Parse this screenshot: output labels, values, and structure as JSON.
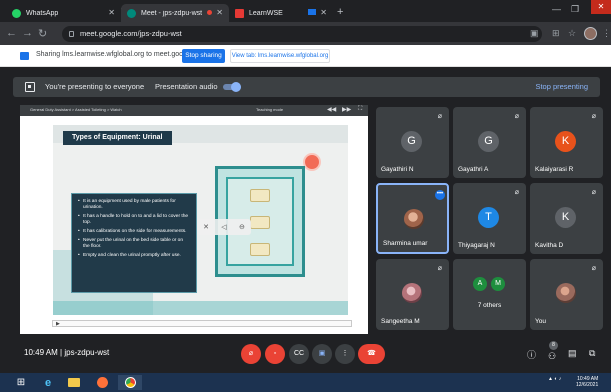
{
  "browser": {
    "tabs": [
      {
        "title": "WhatsApp",
        "favicon_color": "#25d366"
      },
      {
        "title": "Meet - jps-zdpu-wst",
        "favicon_color": "#00897b"
      },
      {
        "title": "LearnWSE",
        "favicon_color": "#e53935"
      }
    ],
    "url": "meet.google.com/jps-zdpu-wst"
  },
  "sharing_bar": {
    "message": "Sharing lms.learnwise.wfglobal.org to meet.google.com",
    "stop_label": "Stop sharing",
    "view_tab_label": "View tab: lms.learnwise.wfglobal.org"
  },
  "presenting_bar": {
    "status": "You're presenting to everyone",
    "audio_label": "Presentation audio",
    "stop_label": "Stop presenting"
  },
  "slide": {
    "breadcrumb": "General Duty Assistant  >  Assisted Toileting  >  Watch",
    "mode": "Teaching mode",
    "title": "Types of Equipment: Urinal",
    "bullets": [
      "It is an equipment used by male patients for urination.",
      "It has a handle to hold on to and a lid to cover the top.",
      "It has calibrations on the side for measurements.",
      "Never put the urinal on the bed side table or on the floor.",
      "Empty and clean the urinal promptly after use."
    ]
  },
  "participants": [
    {
      "name": "Gayathiri N",
      "initial": "G",
      "color": "#5f6368"
    },
    {
      "name": "Gayathri A",
      "initial": "G",
      "color": "#5f6368"
    },
    {
      "name": "Kalaiyarasi R",
      "initial": "K",
      "color": "#e8521b"
    },
    {
      "name": "Sharmina umar",
      "photo": "#a0644a"
    },
    {
      "name": "Thiyagaraj N",
      "initial": "T",
      "color": "#1e88e5"
    },
    {
      "name": "Kavitha D",
      "initial": "K",
      "color": "#5f6368"
    },
    {
      "name": "Sangeetha M",
      "photo": "#b5737a"
    },
    {
      "name": "You",
      "photo": "#9a6a5d"
    }
  ],
  "others_tile": {
    "label": "7 others",
    "initials": [
      "A",
      "M"
    ]
  },
  "meeting": {
    "time": "10:49 AM",
    "separator": "|",
    "code": "jps-zdpu-wst"
  },
  "people_count": "8",
  "taskbar": {
    "time": "10:49 AM",
    "date": "12/6/2021"
  }
}
